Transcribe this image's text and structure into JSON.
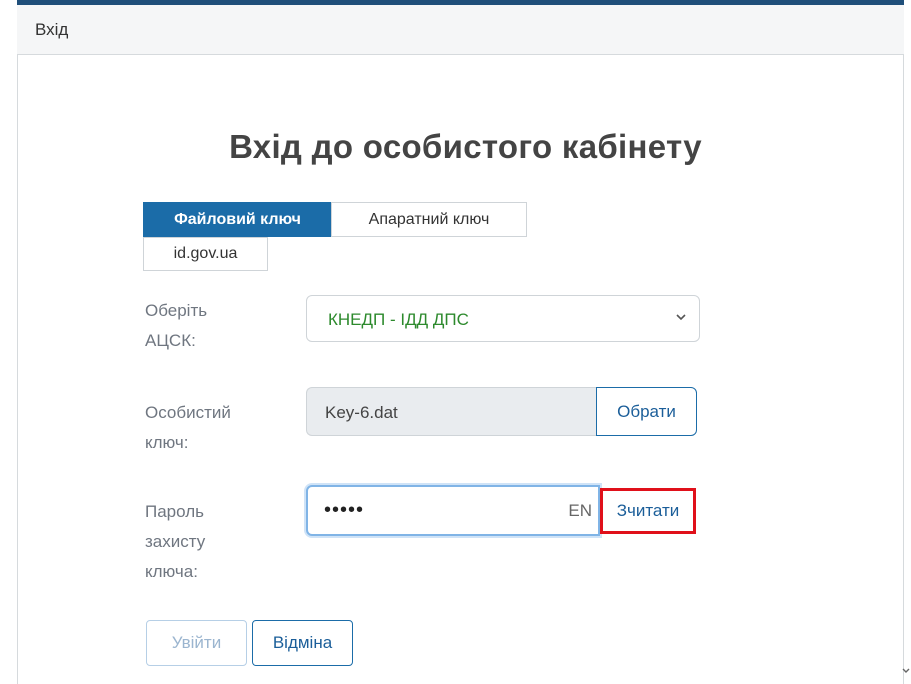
{
  "header": {
    "title": "Вхід"
  },
  "page": {
    "title": "Вхід до особистого кабінету"
  },
  "tabs": [
    {
      "label": "Файловий ключ",
      "active": true
    },
    {
      "label": "Апаратний ключ",
      "active": false
    },
    {
      "label": "id.gov.ua",
      "active": false
    }
  ],
  "form": {
    "acsk_label_line1": "Оберіть",
    "acsk_label_line2": "АЦСК:",
    "acsk_value": "КНЕДП - ІДД ДПС",
    "key_label_line1": "Особистий",
    "key_label_line2": "ключ:",
    "key_value": "Key-6.dat",
    "choose_button": "Обрати",
    "pwd_label_line1": "Пароль",
    "pwd_label_line2": "захисту",
    "pwd_label_line3": "ключа:",
    "pwd_value": "•••••",
    "pwd_lang": "EN",
    "read_button": "Зчитати"
  },
  "actions": {
    "login_button": "Увійти",
    "cancel_button": "Відміна"
  },
  "colors": {
    "accent": "#1b6ca8",
    "highlight": "#e0101a",
    "select_text": "#2d8a2d"
  },
  "icons": [
    "chevron-down-icon",
    "scroll-down-icon"
  ]
}
